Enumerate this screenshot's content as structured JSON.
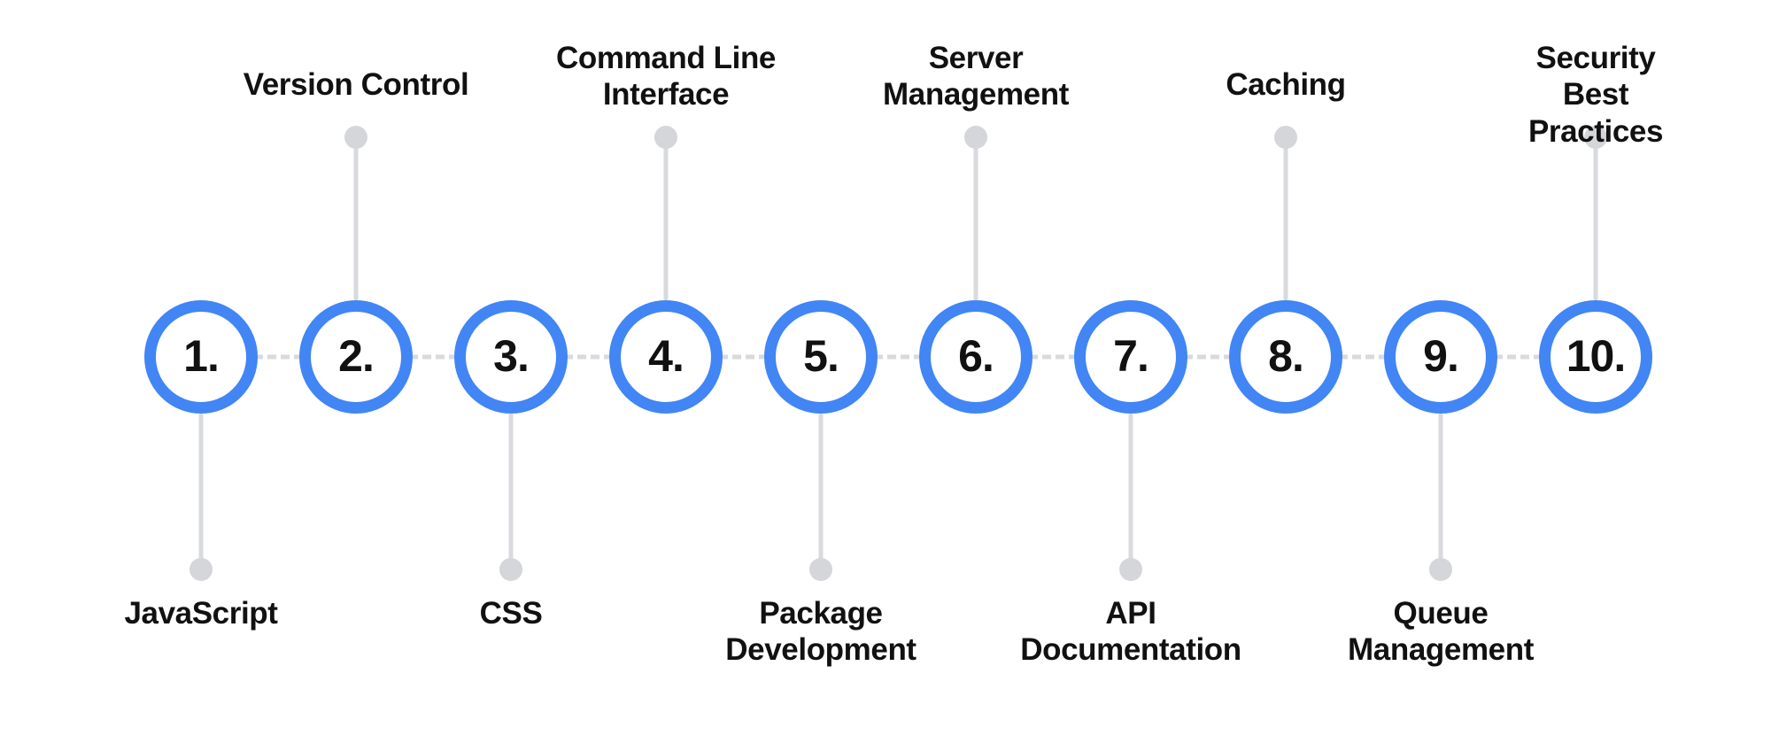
{
  "diagram": {
    "title": "Numbered Roadmap Timeline",
    "type": "horizontal-step-timeline",
    "step_count": 10,
    "colors": {
      "node_ring": "#4285f4",
      "node_fill": "#ffffff",
      "connector": "#d8dadd",
      "stem_dot": "#d4d6d9",
      "label_text": "#111111",
      "background": "#ffffff"
    },
    "steps": [
      {
        "number": "1.",
        "label": "JavaScript",
        "side": "bottom",
        "lines": 1
      },
      {
        "number": "2.",
        "label": "Version Control",
        "side": "top",
        "lines": 1
      },
      {
        "number": "3.",
        "label": "CSS",
        "side": "bottom",
        "lines": 1
      },
      {
        "number": "4.",
        "label": "Command Line\nInterface",
        "side": "top",
        "lines": 2
      },
      {
        "number": "5.",
        "label": "Package\nDevelopment",
        "side": "bottom",
        "lines": 2
      },
      {
        "number": "6.",
        "label": "Server\nManagement",
        "side": "top",
        "lines": 2
      },
      {
        "number": "7.",
        "label": "API\nDocumentation",
        "side": "bottom",
        "lines": 2
      },
      {
        "number": "8.",
        "label": "Caching",
        "side": "top",
        "lines": 1
      },
      {
        "number": "9.",
        "label": "Queue\nManagement",
        "side": "bottom",
        "lines": 2
      },
      {
        "number": "10.",
        "label": "Security Best\nPractices",
        "side": "top",
        "lines": 2
      }
    ]
  }
}
